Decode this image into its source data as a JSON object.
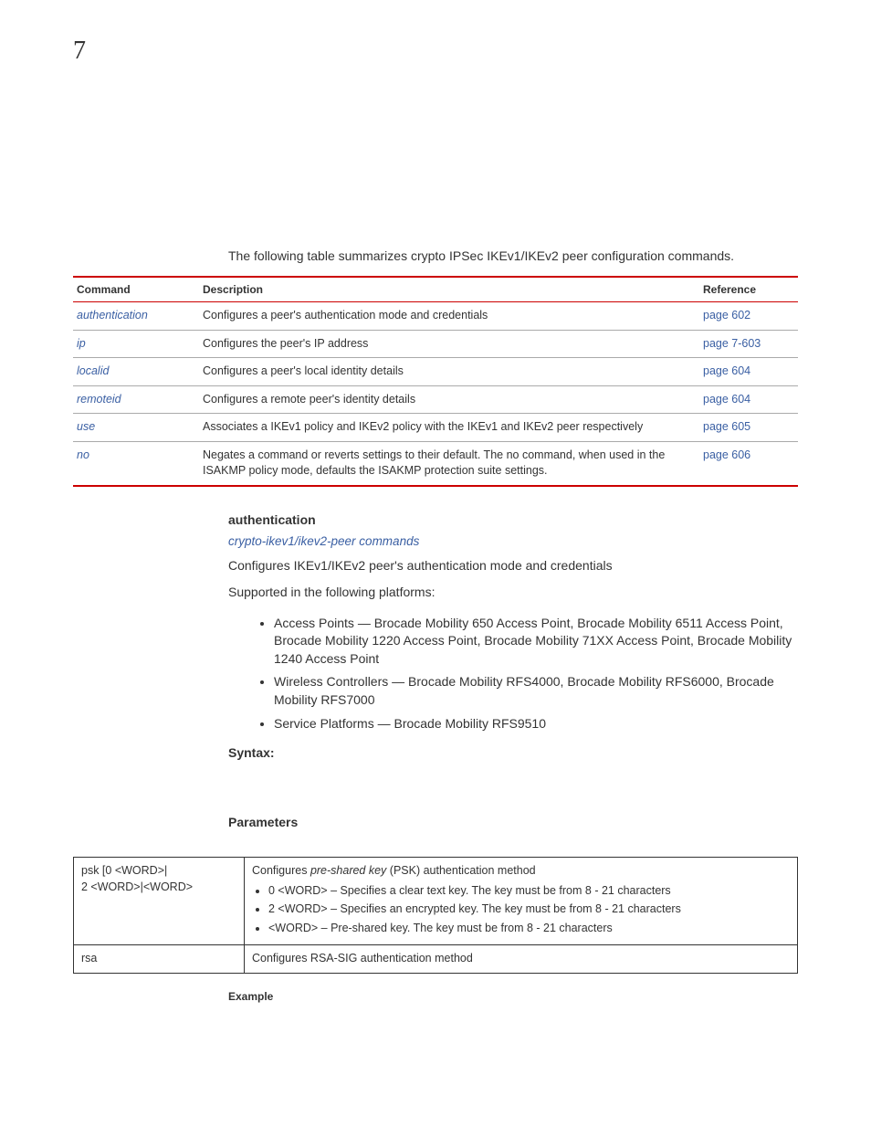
{
  "chapter_number": "7",
  "intro": "The following table summarizes crypto IPSec IKEv1/IKEv2 peer configuration commands.",
  "cmd_table": {
    "headers": {
      "command": "Command",
      "description": "Description",
      "reference": "Reference"
    },
    "rows": [
      {
        "command": "authentication",
        "description": "Configures a peer's authentication mode and credentials",
        "reference": "page 602"
      },
      {
        "command": "ip",
        "description": "Configures the peer's IP address",
        "reference": "page 7-603"
      },
      {
        "command": "localid",
        "description": "Configures a peer's local identity details",
        "reference": "page 604"
      },
      {
        "command": "remoteid",
        "description": "Configures a remote peer's identity details",
        "reference": "page 604"
      },
      {
        "command": "use",
        "description": "Associates a IKEv1 policy and IKEv2 policy with the IKEv1 and IKEv2 peer respectively",
        "reference": "page 605"
      },
      {
        "command": "no",
        "description": "Negates a command or reverts settings to their default. The no command, when used in the ISAKMP policy mode, defaults the ISAKMP protection suite settings.",
        "reference": "page 606"
      }
    ]
  },
  "section": {
    "title": "authentication",
    "breadcrumb": "crypto-ikev1/ikev2-peer commands",
    "desc": "Configures IKEv1/IKEv2 peer's authentication mode and credentials",
    "supported_label": "Supported in the following platforms:",
    "platforms": [
      "Access Points — Brocade Mobility 650 Access Point, Brocade Mobility 6511 Access Point, Brocade Mobility 1220 Access Point, Brocade Mobility 71XX Access Point, Brocade Mobility 1240 Access Point",
      "Wireless Controllers — Brocade Mobility RFS4000, Brocade Mobility RFS6000, Brocade Mobility RFS7000",
      "Service Platforms — Brocade Mobility RFS9510"
    ],
    "syntax_label": "Syntax:",
    "params_label": "Parameters",
    "param_rows": [
      {
        "param": "psk [0 <WORD>|\n2 <WORD>|<WORD>",
        "desc_lead_a": "Configures ",
        "desc_lead_em": "pre-shared key",
        "desc_lead_b": " (PSK) authentication method",
        "bullets": [
          "0 <WORD> – Specifies a clear text key. The key must be from 8 - 21 characters",
          "2 <WORD> – Specifies an encrypted key. The key must be from 8 - 21 characters",
          "<WORD> – Pre-shared key. The key must be from 8 - 21 characters"
        ]
      },
      {
        "param": "rsa",
        "desc_plain": "Configures RSA-SIG authentication method"
      }
    ],
    "example_label": "Example"
  }
}
